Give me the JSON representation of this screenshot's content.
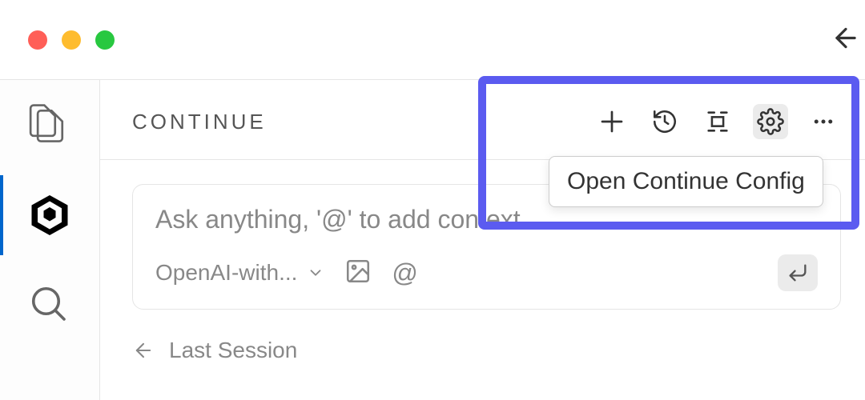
{
  "panel": {
    "title": "CONTINUE"
  },
  "input": {
    "placeholder": "Ask anything, '@' to add context",
    "model": "OpenAI-with..."
  },
  "tooltip": {
    "text": "Open Continue Config"
  },
  "last_session": {
    "label": "Last Session"
  }
}
